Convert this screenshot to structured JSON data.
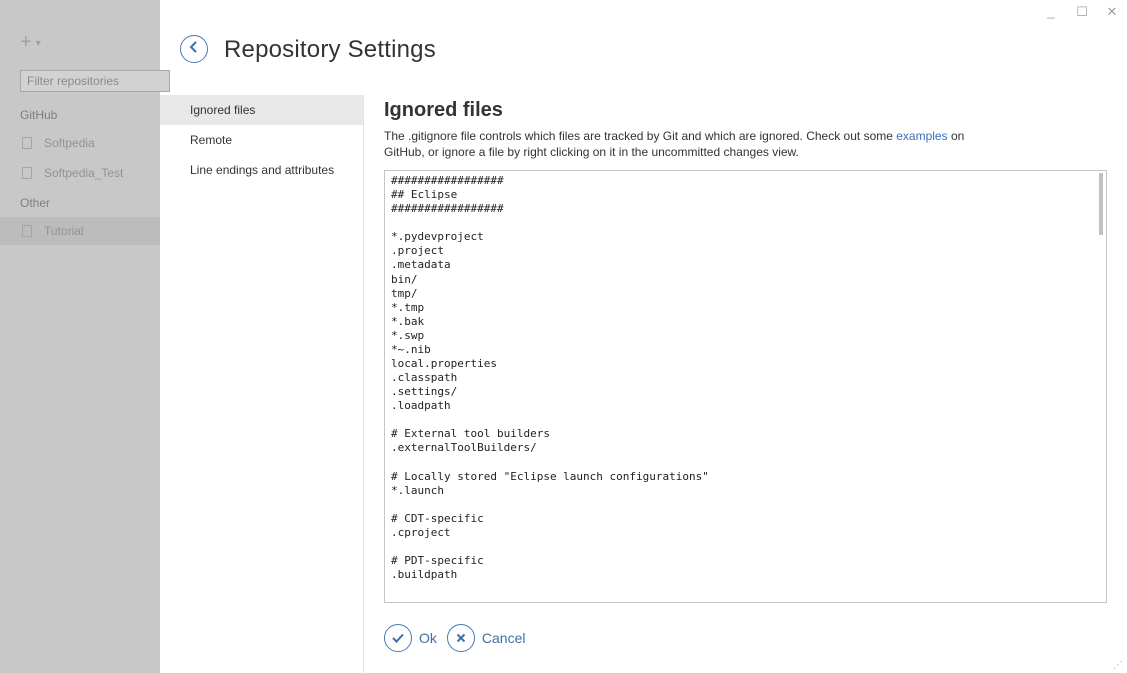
{
  "sidebar": {
    "add_icon": "+",
    "filter_placeholder": "Filter repositories",
    "groups": [
      {
        "label": "GitHub",
        "items": [
          "Softpedia",
          "Softpedia_Test"
        ]
      },
      {
        "label": "Other",
        "items": [
          "Tutorial"
        ]
      }
    ]
  },
  "window": {
    "minimize": "_",
    "maximize": "☐",
    "close": "✕"
  },
  "header": {
    "title": "Repository Settings",
    "back_icon": "‹"
  },
  "nav": {
    "items": [
      "Ignored files",
      "Remote",
      "Line endings and attributes"
    ],
    "active": "Ignored files"
  },
  "content": {
    "title": "Ignored files",
    "description_before": "The .gitignore file controls which files are tracked by Git and which are ignored. Check out some ",
    "description_link": "examples",
    "description_after": " on GitHub, or ignore a file by right clicking on it in the uncommitted changes view.",
    "gitignore": "#################\n## Eclipse\n#################\n\n*.pydevproject\n.project\n.metadata\nbin/\ntmp/\n*.tmp\n*.bak\n*.swp\n*~.nib\nlocal.properties\n.classpath\n.settings/\n.loadpath\n\n# External tool builders\n.externalToolBuilders/\n\n# Locally stored \"Eclipse launch configurations\"\n*.launch\n\n# CDT-specific\n.cproject\n\n# PDT-specific\n.buildpath"
  },
  "actions": {
    "ok_label": "Ok",
    "cancel_label": "Cancel"
  },
  "colors": {
    "accent": "#3d6fa9",
    "sidebar_bg": "#c8c8c8"
  }
}
